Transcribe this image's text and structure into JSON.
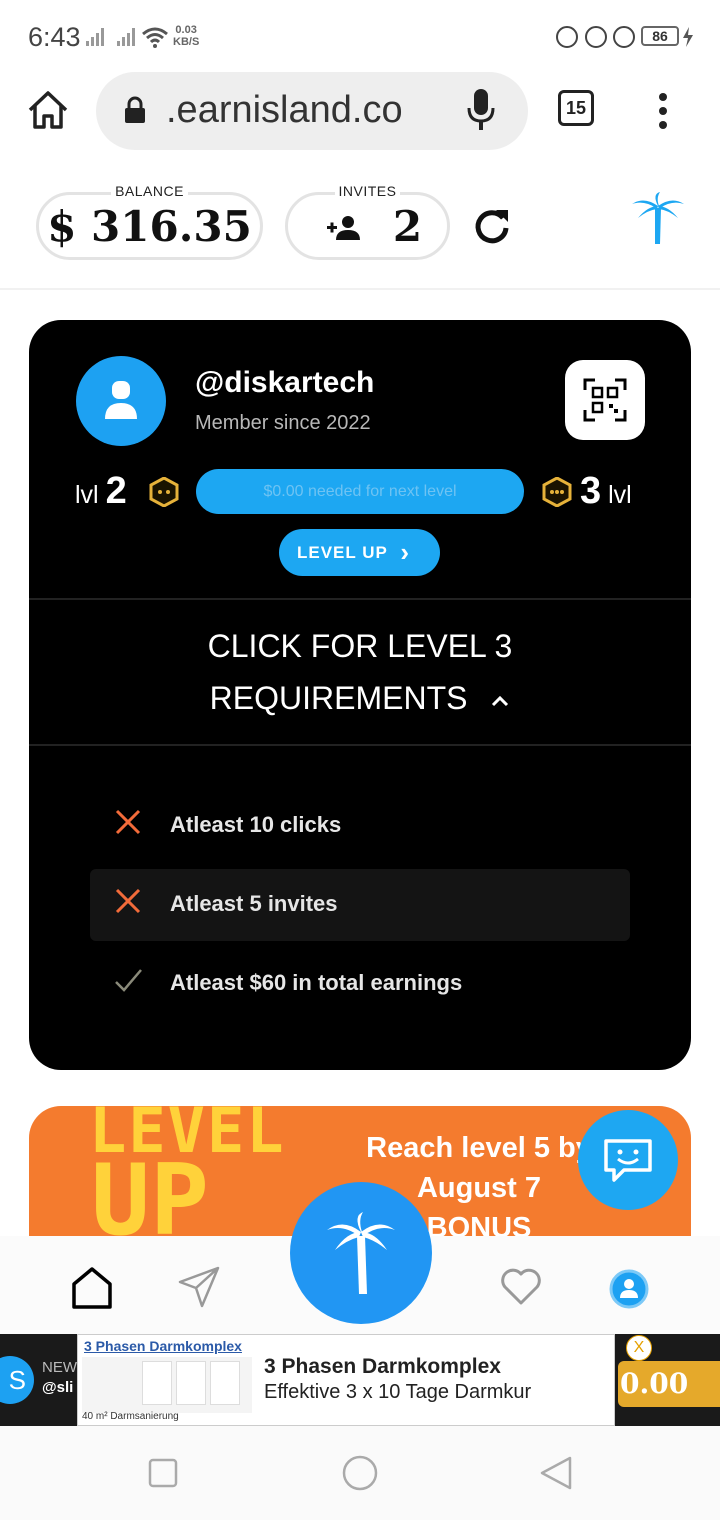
{
  "status_bar": {
    "time": "6:43",
    "speed_value": "0.03",
    "speed_unit": "KB/S",
    "battery": "86"
  },
  "browser": {
    "url": ".earnisland.co",
    "tab_count": "15"
  },
  "wallet": {
    "balance_label": "BALANCE",
    "balance_value": "$ 316.35",
    "invites_label": "INVITES",
    "invites_value": "2"
  },
  "profile": {
    "username": "@diskartech",
    "member_since": "Member since 2022",
    "level_prefix": "lvl",
    "current_level": "2",
    "next_level": "3",
    "level_suffix": "lvl",
    "progress_text": "$0.00 needed for next level",
    "level_up_label": "LEVEL UP"
  },
  "requirements": {
    "title_line1": "CLICK FOR LEVEL 3",
    "title_line2": "REQUIREMENTS",
    "items": [
      {
        "text": "Atleast 10 clicks",
        "status": "failed"
      },
      {
        "text": "Atleast 5 invites",
        "status": "failed"
      },
      {
        "text": "Atleast $60 in total earnings",
        "status": "done"
      }
    ]
  },
  "promo": {
    "art_level": "LEVEL",
    "art_up": "UP",
    "text_line1": "Reach level 5 by",
    "text_line2": "August 7",
    "text_line3": "BONUS"
  },
  "ad": {
    "left_initial": "S",
    "left_line1": "NEW",
    "left_line2": "@sli",
    "brand_small": "3 Phasen Darmkomplex",
    "image_caption": "40 m² Darmsanierung",
    "headline": "3 Phasen Darmkomplex",
    "subline": "Effektive 3 x 10 Tage Darmkur",
    "close_label": "X",
    "right_value": "0.00"
  },
  "colors": {
    "accent_blue": "#1da7f2",
    "card_bg": "#000000",
    "promo_orange": "#f47b2e",
    "fail_orange": "#f26b3a",
    "check_gray": "#8a8a7a"
  }
}
